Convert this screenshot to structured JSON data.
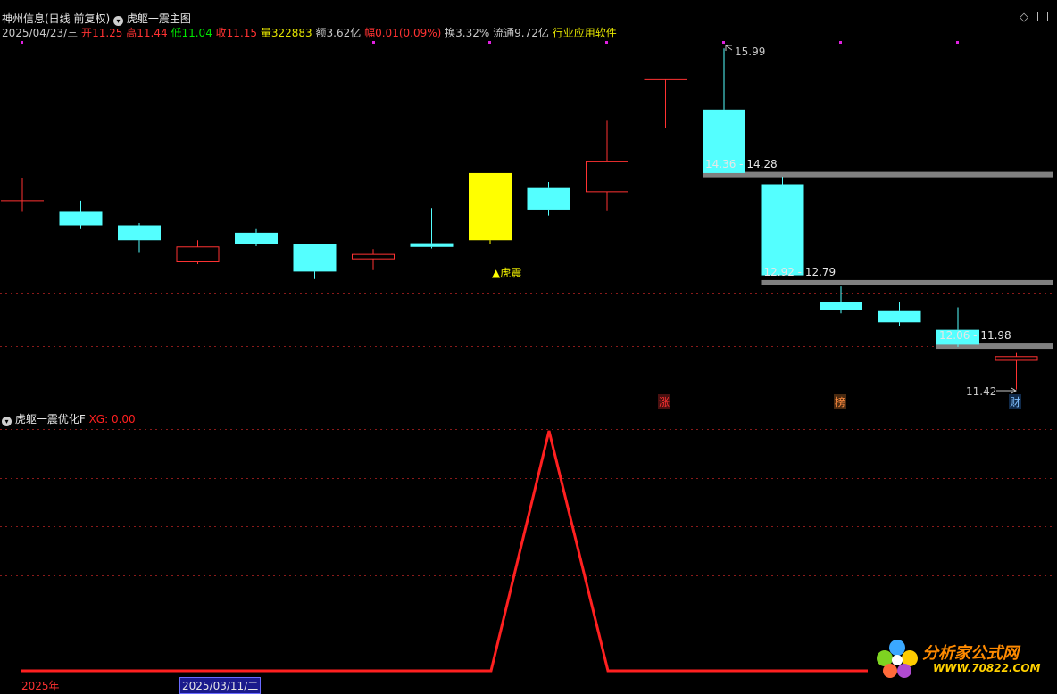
{
  "header": {
    "title": "神州信息(日线 前复权)",
    "indicator_name": "虎躯一震主图",
    "date": "2025/04/23/三",
    "open_label": "开",
    "open": "11.25",
    "high_label": "高",
    "high": "11.44",
    "low_label": "低",
    "low": "11.04",
    "close_label": "收",
    "close": "11.15",
    "volume_label": "量",
    "volume": "322883",
    "amount_label": "额",
    "amount": "3.62亿",
    "change_label": "幅",
    "change": "0.01(0.09%)",
    "turnover_label": "换",
    "turnover": "3.32%",
    "float_label": "流通",
    "float_cap": "9.72亿",
    "industry": "行业应用软件"
  },
  "sub_header": {
    "indicator_name": "虎躯一震优化F",
    "xg_label": "XG: 0.00"
  },
  "markers": {
    "signal": "▲虎震",
    "zhang": "涨",
    "bang": "榜",
    "cai": "财",
    "high_price": "15.99",
    "low_price": "11.42"
  },
  "zones": [
    {
      "label": "14.36 - 14.28",
      "value": 14.3
    },
    {
      "label": "12.92 - 12.79",
      "value": 12.85
    },
    {
      "label": "12.06 - 11.98",
      "value": 12.0
    }
  ],
  "footer": {
    "year_label": "2025年",
    "cursor_date": "2025/03/11/二"
  },
  "watermark": {
    "line1": "分析家公式网",
    "line2": "WWW.70822.COM"
  },
  "colors": {
    "up": "#ff3232",
    "down": "#54ffff",
    "signal": "#ffff00",
    "zone": "#808080",
    "indicator": "#ff2020"
  },
  "chart_data": [
    {
      "type": "candlestick",
      "title": "神州信息(日线 前复权)",
      "ylim": [
        11.2,
        16.1
      ],
      "candles": [
        {
          "open": 13.95,
          "close": 13.95,
          "high": 14.25,
          "low": 13.8,
          "color": "up"
        },
        {
          "open": 13.8,
          "close": 13.62,
          "high": 13.95,
          "low": 13.57,
          "color": "down"
        },
        {
          "open": 13.62,
          "close": 13.42,
          "high": 13.65,
          "low": 13.25,
          "color": "down"
        },
        {
          "open": 13.13,
          "close": 13.33,
          "high": 13.42,
          "low": 13.1,
          "color": "up"
        },
        {
          "open": 13.52,
          "close": 13.37,
          "high": 13.57,
          "low": 13.34,
          "color": "down"
        },
        {
          "open": 13.37,
          "close": 13.0,
          "high": 13.37,
          "low": 12.9,
          "color": "down"
        },
        {
          "open": 13.17,
          "close": 13.23,
          "high": 13.3,
          "low": 13.02,
          "color": "up"
        },
        {
          "open": 13.38,
          "close": 13.33,
          "high": 13.85,
          "low": 13.31,
          "color": "down"
        },
        {
          "open": 14.32,
          "close": 13.42,
          "high": 14.32,
          "low": 13.37,
          "color": "signal"
        },
        {
          "open": 14.12,
          "close": 13.83,
          "high": 14.2,
          "low": 13.75,
          "color": "down"
        },
        {
          "open": 14.07,
          "close": 14.47,
          "high": 15.02,
          "low": 13.82,
          "color": "up"
        },
        {
          "open": 15.57,
          "close": 15.57,
          "high": 15.57,
          "low": 14.92,
          "color": "up"
        },
        {
          "open": 15.17,
          "close": 14.32,
          "high": 15.99,
          "low": 14.32,
          "color": "down"
        },
        {
          "open": 14.17,
          "close": 12.95,
          "high": 14.27,
          "low": 12.95,
          "color": "down"
        },
        {
          "open": 12.59,
          "close": 12.49,
          "high": 12.8,
          "low": 12.44,
          "color": "down"
        },
        {
          "open": 12.47,
          "close": 12.32,
          "high": 12.59,
          "low": 12.27,
          "color": "down"
        },
        {
          "open": 12.22,
          "close": 12.02,
          "high": 12.52,
          "low": 11.99,
          "color": "down"
        },
        {
          "open": 11.86,
          "close": 11.81,
          "high": 11.91,
          "low": 11.42,
          "color": "up"
        }
      ]
    },
    {
      "type": "line",
      "series": [
        {
          "name": "XG",
          "values": [
            0,
            0,
            0,
            0,
            0,
            0,
            0,
            0,
            0,
            0,
            0,
            0,
            0,
            0,
            0,
            0,
            0,
            0,
            0,
            0,
            0,
            0,
            0,
            0,
            0,
            0,
            0,
            0,
            0,
            0,
            0,
            0,
            0,
            0,
            0,
            0,
            0,
            0,
            0,
            0,
            0,
            0,
            0,
            0,
            0,
            0,
            0,
            0,
            0,
            0,
            0,
            0,
            0,
            0,
            0,
            0,
            0,
            0,
            0,
            0
          ]
        }
      ],
      "peak": {
        "x_index": 9,
        "value": 1
      },
      "ylim": [
        0,
        1.1
      ]
    }
  ]
}
